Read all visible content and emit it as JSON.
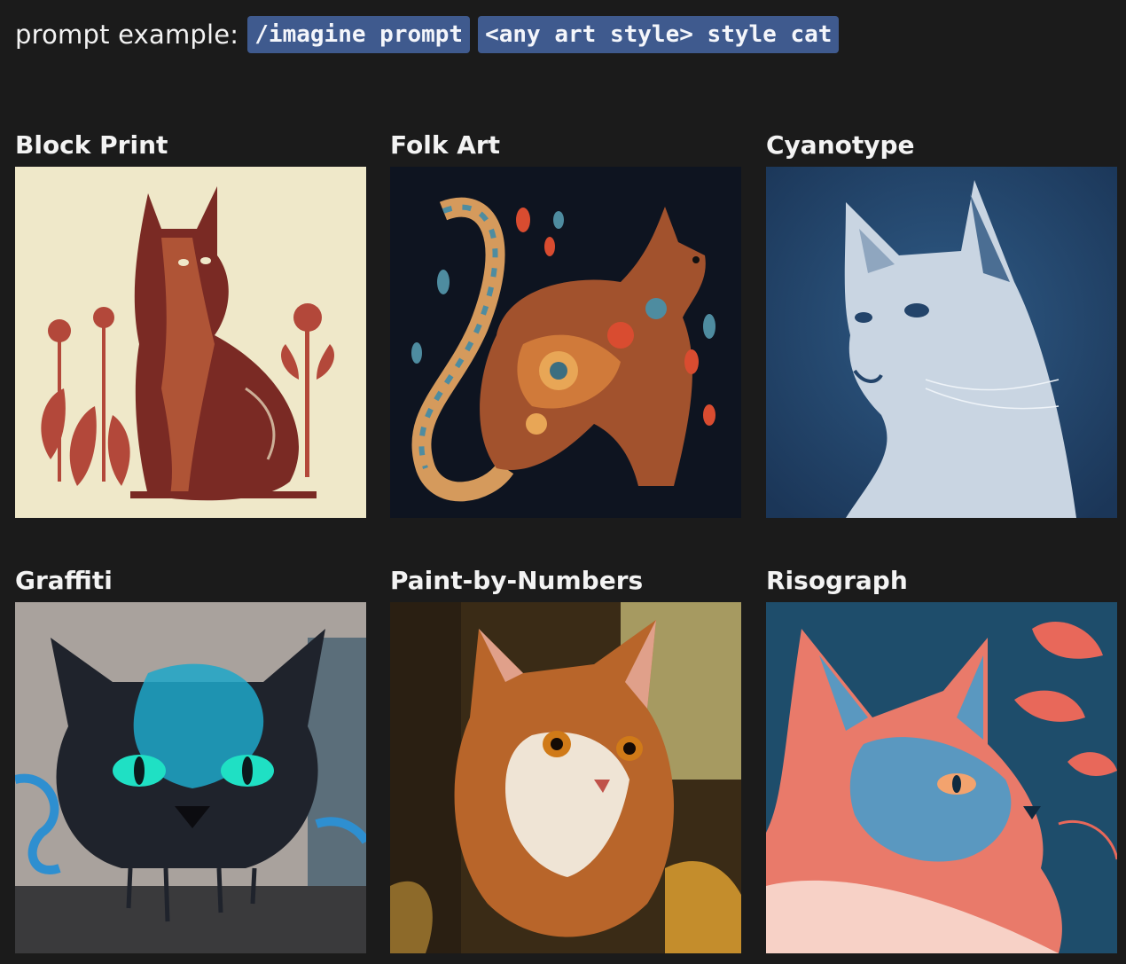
{
  "prompt": {
    "label": "prompt example:",
    "chips": [
      "/imagine prompt",
      "<any art style> style cat"
    ]
  },
  "styles": [
    {
      "title": "Block Print",
      "image": "block-print-cat"
    },
    {
      "title": "Folk Art",
      "image": "folk-art-cat"
    },
    {
      "title": "Cyanotype",
      "image": "cyanotype-cat"
    },
    {
      "title": "Graffiti",
      "image": "graffiti-cat"
    },
    {
      "title": "Paint-by-Numbers",
      "image": "paint-by-numbers-cat"
    },
    {
      "title": "Risograph",
      "image": "risograph-cat"
    }
  ]
}
